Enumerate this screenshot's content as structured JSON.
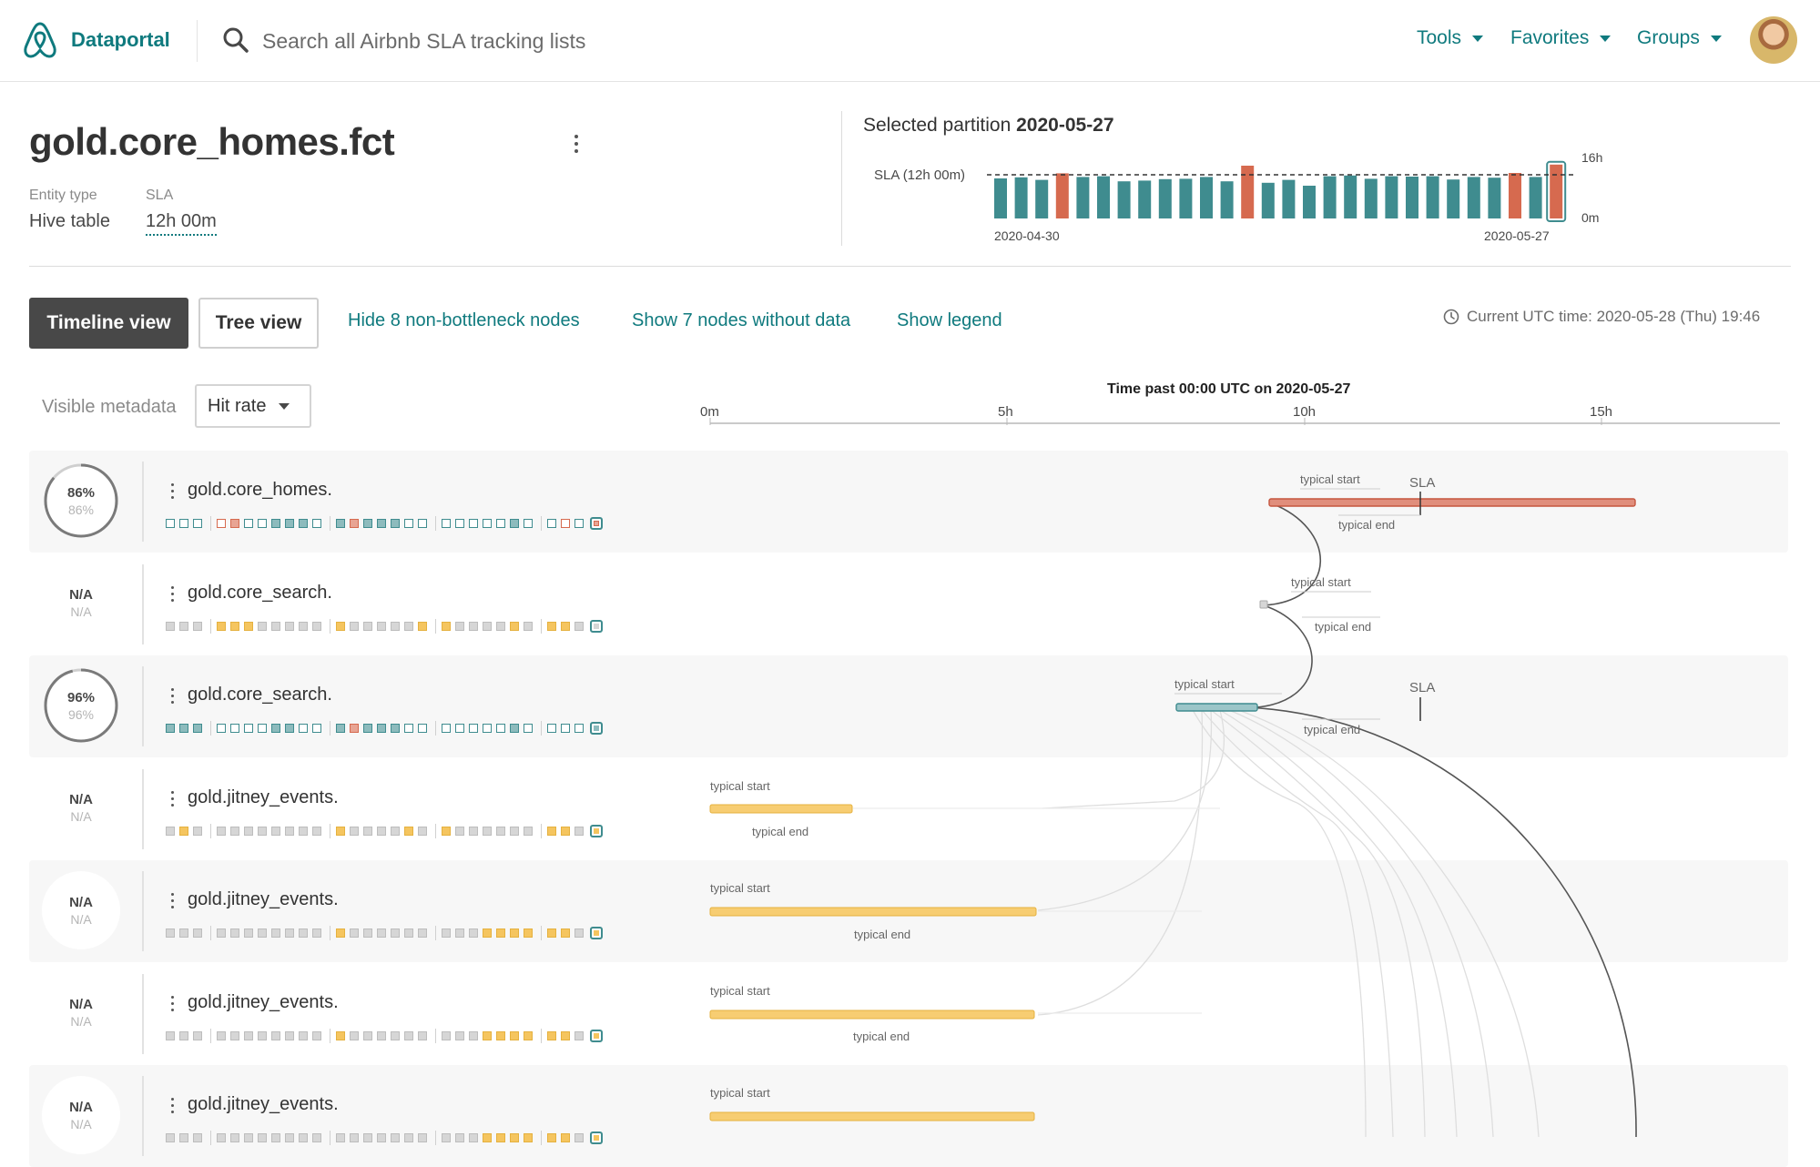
{
  "app": {
    "name": "Dataportal"
  },
  "search": {
    "placeholder": "Search all Airbnb SLA tracking lists"
  },
  "nav": [
    {
      "label": "Tools"
    },
    {
      "label": "Favorites"
    },
    {
      "label": "Groups"
    }
  ],
  "entity": {
    "title": "gold.core_homes.fct",
    "entity_type_label": "Entity type",
    "entity_type_value": "Hive table",
    "sla_label": "SLA",
    "sla_value": "12h 00m"
  },
  "partition": {
    "prefix": "Selected partition",
    "date": "2020-05-27",
    "sla_line_label": "SLA (12h 00m)",
    "y_max_label": "16h",
    "y_min_label": "0m",
    "x_start_label": "2020-04-30",
    "x_end_label": "2020-05-27"
  },
  "chart_data": {
    "type": "bar",
    "title": "",
    "xlabel": "",
    "ylabel": "",
    "ylim": [
      0,
      16
    ],
    "sla_hours": 12,
    "values": [
      11,
      11.3,
      10.6,
      12.4,
      11.4,
      11.6,
      10.2,
      10.4,
      10.8,
      10.9,
      11.4,
      10.2,
      14.5,
      9.8,
      10.6,
      9.0,
      11.6,
      11.8,
      10.9,
      11.6,
      11.5,
      11.6,
      10.7,
      11.4,
      11.2,
      12.5,
      11.4,
      14.8
    ],
    "colors": {
      "ok": "#3f8c8f",
      "breach": "#d66a4f",
      "selected_border": "#3f8c8f"
    },
    "breach_indices": [
      3,
      12,
      25,
      27
    ],
    "selected_index": 27
  },
  "toolbar": {
    "timeline_view": "Timeline view",
    "tree_view": "Tree view",
    "hide_nodes": "Hide 8 non-bottleneck nodes",
    "show_nodes": "Show 7 nodes without data",
    "show_legend": "Show legend",
    "utc_time": "Current UTC time: 2020-05-28 (Thu) 19:46"
  },
  "metadata": {
    "label": "Visible metadata",
    "selected": "Hit rate"
  },
  "timeline": {
    "axis_title": "Time past 00:00 UTC on 2020-05-27",
    "ticks": [
      "0m",
      "5h",
      "10h",
      "15h"
    ],
    "typical_start": "typical start",
    "typical_end": "typical end",
    "sla": "SLA"
  },
  "colors": {
    "accent": "#0f7a7e",
    "teal": "#3f8c8f",
    "red": "#d66a4f",
    "yellow": "#f5c55f",
    "gray": "#d6d6d6"
  },
  "rows": [
    {
      "name": "gold.core_homes.",
      "pct": "86%",
      "pct2": "86%",
      "ring": true,
      "squares": [
        "te",
        "te",
        "te",
        "|",
        "re",
        "rf",
        "te",
        "te",
        "tf",
        "tf",
        "tf",
        "te",
        "|",
        "tf",
        "rf",
        "tf",
        "tf",
        "tf",
        "te",
        "te",
        "|",
        "te",
        "te",
        "te",
        "te",
        "te",
        "tf",
        "te",
        "|",
        "te",
        "re",
        "te"
      ],
      "last": "r"
    },
    {
      "name": "gold.core_search.",
      "pct": "N/A",
      "pct2": "N/A",
      "ring": false,
      "squares": [
        "g",
        "g",
        "g",
        "|",
        "y",
        "y",
        "y",
        "g",
        "g",
        "g",
        "g",
        "g",
        "|",
        "y",
        "g",
        "g",
        "g",
        "g",
        "g",
        "y",
        "|",
        "y",
        "g",
        "g",
        "g",
        "g",
        "y",
        "g",
        "|",
        "y",
        "y",
        "g"
      ],
      "last": "g"
    },
    {
      "name": "gold.core_search.",
      "pct": "96%",
      "pct2": "96%",
      "ring": true,
      "squares": [
        "tf",
        "tf",
        "tf",
        "|",
        "te",
        "te",
        "te",
        "te",
        "tf",
        "tf",
        "te",
        "te",
        "|",
        "tf",
        "rf",
        "tf",
        "tf",
        "tf",
        "te",
        "te",
        "|",
        "te",
        "te",
        "te",
        "te",
        "te",
        "tf",
        "te",
        "|",
        "te",
        "te",
        "te"
      ],
      "last": "t"
    },
    {
      "name": "gold.jitney_events.",
      "pct": "N/A",
      "pct2": "N/A",
      "ring": false,
      "squares": [
        "g",
        "y",
        "g",
        "|",
        "g",
        "g",
        "g",
        "g",
        "g",
        "g",
        "g",
        "g",
        "|",
        "y",
        "g",
        "g",
        "g",
        "g",
        "y",
        "g",
        "|",
        "y",
        "g",
        "g",
        "g",
        "g",
        "g",
        "g",
        "|",
        "y",
        "y",
        "g"
      ],
      "last": "y"
    },
    {
      "name": "gold.jitney_events.",
      "pct": "N/A",
      "pct2": "N/A",
      "ring": false,
      "squares": [
        "g",
        "g",
        "g",
        "|",
        "g",
        "g",
        "g",
        "g",
        "g",
        "g",
        "g",
        "g",
        "|",
        "y",
        "g",
        "g",
        "g",
        "g",
        "g",
        "g",
        "|",
        "g",
        "g",
        "g",
        "y",
        "y",
        "y",
        "y",
        "|",
        "y",
        "y",
        "g"
      ],
      "last": "y"
    },
    {
      "name": "gold.jitney_events.",
      "pct": "N/A",
      "pct2": "N/A",
      "ring": false,
      "squares": [
        "g",
        "g",
        "g",
        "|",
        "g",
        "g",
        "g",
        "g",
        "g",
        "g",
        "g",
        "g",
        "|",
        "y",
        "g",
        "g",
        "g",
        "g",
        "g",
        "g",
        "|",
        "g",
        "g",
        "g",
        "y",
        "y",
        "y",
        "y",
        "|",
        "y",
        "y",
        "g"
      ],
      "last": "y"
    },
    {
      "name": "gold.jitney_events.",
      "pct": "N/A",
      "pct2": "N/A",
      "ring": false,
      "squares": [
        "g",
        "g",
        "g",
        "|",
        "g",
        "g",
        "g",
        "g",
        "g",
        "g",
        "g",
        "g",
        "|",
        "g",
        "g",
        "g",
        "g",
        "g",
        "g",
        "g",
        "|",
        "g",
        "g",
        "g",
        "y",
        "y",
        "y",
        "y",
        "|",
        "y",
        "y",
        "g"
      ],
      "last": "y"
    }
  ]
}
